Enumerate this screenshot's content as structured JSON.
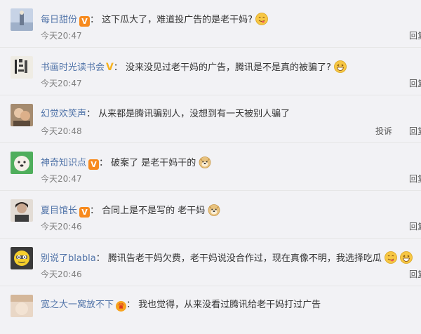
{
  "comments": [
    {
      "name": "每日甜份",
      "badge": "V",
      "text": "这下瓜大了，难道投广告的是老干妈?",
      "time": "今天20:47",
      "reply": "回复"
    },
    {
      "name": "书画时光读书会",
      "badge": "V",
      "text": "没来没见过老干妈的广告，腾讯是不是真的被骗了?",
      "time": "今天20:47",
      "reply": "回复"
    },
    {
      "name": "幻觉欢笑声",
      "badge": "",
      "text": "从来都是腾讯骗别人，没想到有一天被别人骗了",
      "time": "今天20:48",
      "report": "投诉",
      "reply": "回复"
    },
    {
      "name": "神奇知识点",
      "badge": "V",
      "text": "破案了 是老干妈干的",
      "time": "今天20:47",
      "reply": "回复"
    },
    {
      "name": "夏目馆长",
      "badge": "V",
      "text": "合同上是不是写的 老干妈",
      "time": "今天20:46",
      "reply": "回复"
    },
    {
      "name": "别说了blabla",
      "badge": "",
      "text": "腾讯告老干妈欠费，老干妈说没合作过，现在真像不明，我选择吃瓜",
      "time": "今天20:46",
      "reply": "回复"
    },
    {
      "name": "宽之大一窝放不下",
      "badge": "crown",
      "text": "我也觉得，从来没看过腾讯给老干妈打过广告",
      "time": "",
      "reply": ""
    }
  ],
  "separator": "：",
  "colors": {
    "name": "#5073a8",
    "badge": "#f78a1e",
    "background": "#f2f2f5",
    "time": "#808080"
  },
  "icons": [
    "savor-emoji-icon",
    "grin-emoji-icon",
    "doge-emoji-icon",
    "vip-badge-icon",
    "crown-badge-icon"
  ]
}
